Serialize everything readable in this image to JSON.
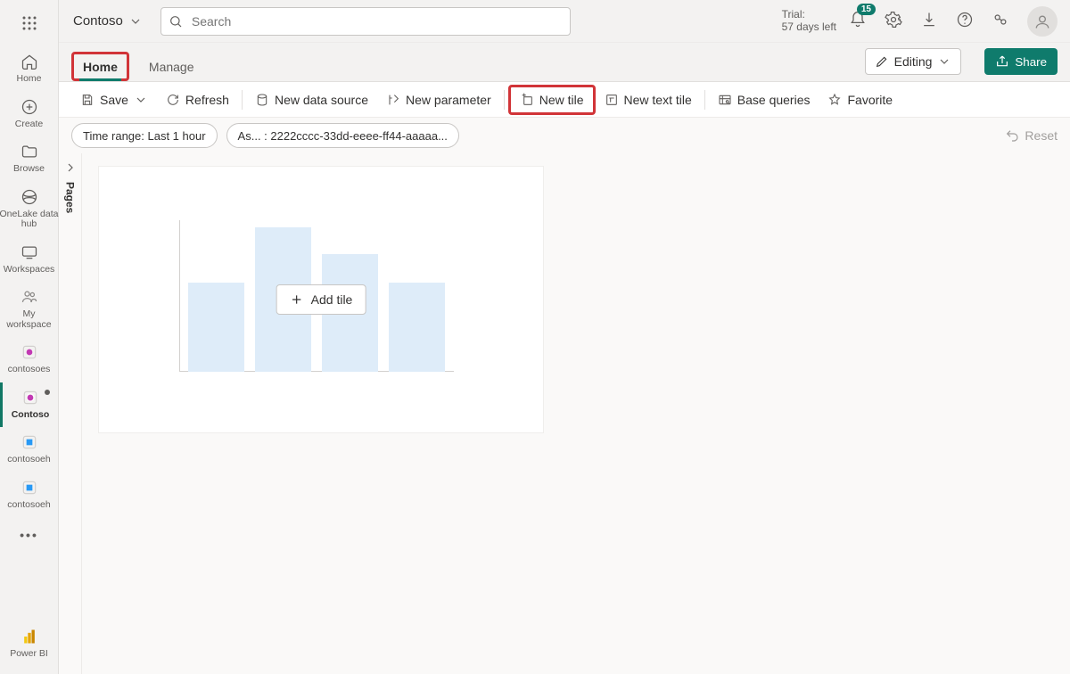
{
  "brand": {
    "name": "Contoso"
  },
  "search": {
    "placeholder": "Search"
  },
  "trial": {
    "line1": "Trial:",
    "line2": "57 days left"
  },
  "notifications": {
    "count": "15"
  },
  "leftrail": {
    "items": [
      {
        "label": "Home"
      },
      {
        "label": "Create"
      },
      {
        "label": "Browse"
      },
      {
        "label": "OneLake data hub"
      },
      {
        "label": "Workspaces"
      },
      {
        "label": "My workspace"
      },
      {
        "label": "contosoes"
      },
      {
        "label": "Contoso"
      },
      {
        "label": "contosoeh"
      },
      {
        "label": "contosoeh"
      }
    ],
    "bottom": {
      "label": "Power BI"
    }
  },
  "tabs": {
    "items": [
      "Home",
      "Manage"
    ],
    "editing_label": "Editing",
    "share_label": "Share"
  },
  "toolbar": {
    "save": "Save",
    "refresh": "Refresh",
    "new_data_source": "New data source",
    "new_parameter": "New parameter",
    "new_tile": "New tile",
    "new_text_tile": "New text tile",
    "base_queries": "Base queries",
    "favorite": "Favorite"
  },
  "pillbar": {
    "time_range": "Time range: Last 1 hour",
    "param": "As... : 2222cccc-33dd-eeee-ff44-aaaaa...",
    "reset": "Reset"
  },
  "pages": {
    "label": "Pages"
  },
  "tile": {
    "add_tile": "Add tile"
  }
}
